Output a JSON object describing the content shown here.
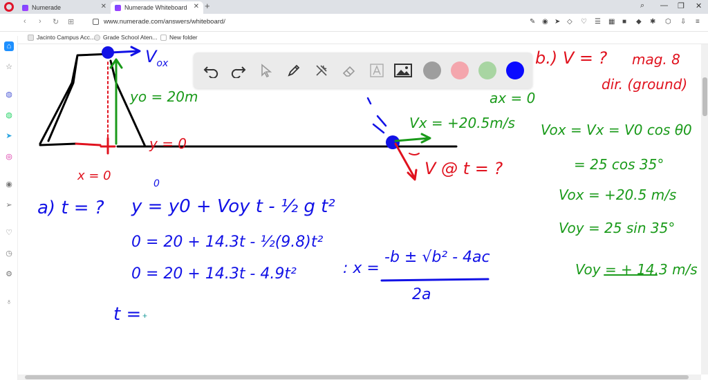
{
  "browser": {
    "tabs": [
      {
        "label": "Numerade"
      },
      {
        "label": "Numerade Whiteboard"
      }
    ],
    "url": "www.numerade.com/answers/whiteboard/",
    "bookmarks": [
      {
        "label": "Jacinto Campus Acc..."
      },
      {
        "label": "Grade School Aten..."
      },
      {
        "label": "New folder"
      }
    ]
  },
  "toolbar": {
    "tools": [
      "undo-icon",
      "redo-icon",
      "select-icon",
      "pen-icon",
      "tools-icon",
      "eraser-icon",
      "text-icon",
      "image-icon"
    ],
    "colors": [
      "#9e9e9e",
      "#f4a6ad",
      "#a8d5a2",
      "#0a0aff"
    ],
    "active_color": "#0a0aff"
  },
  "whiteboard": {
    "blue": "#1212e6",
    "green": "#1a9a1a",
    "red": "#e0121e",
    "labels": {
      "vox": "V",
      "vox_sub": "ox",
      "yo": "y",
      "yo_rest": "o = 20m",
      "y0": "y = 0",
      "x0": "x = 0",
      "ax": "a",
      "ax_rest": "x = 0",
      "vx_ground": "x = +20.5m/s",
      "v_at_t": "@ t = ?",
      "part_b": "b.) V = ?",
      "mag": "mag. 8",
      "dir": "dir. (ground)",
      "eq_vox": "ox = Vx = V0 cos θ0",
      "eq_cos": "= 25 cos 35°",
      "eq_vox_val": "ox = +20.5 m/s",
      "eq_voy": "oy = 25 sin 35°",
      "eq_voy_val": "oy = + 14.3 m/s",
      "part_a": "a)  t = ?",
      "eq1": "y = y0 + Voy t - ½ g t²",
      "eq1_zero": "0",
      "eq2": "0 = 20 + 14.3t - ½(9.8)t²",
      "eq3": "0 = 20 + 14.3t - 4.9t²",
      "quad_lhs": ": x =",
      "quad_num": "-b ± √b² - 4ac",
      "quad_den": "2a",
      "t_eq": "t ="
    }
  }
}
